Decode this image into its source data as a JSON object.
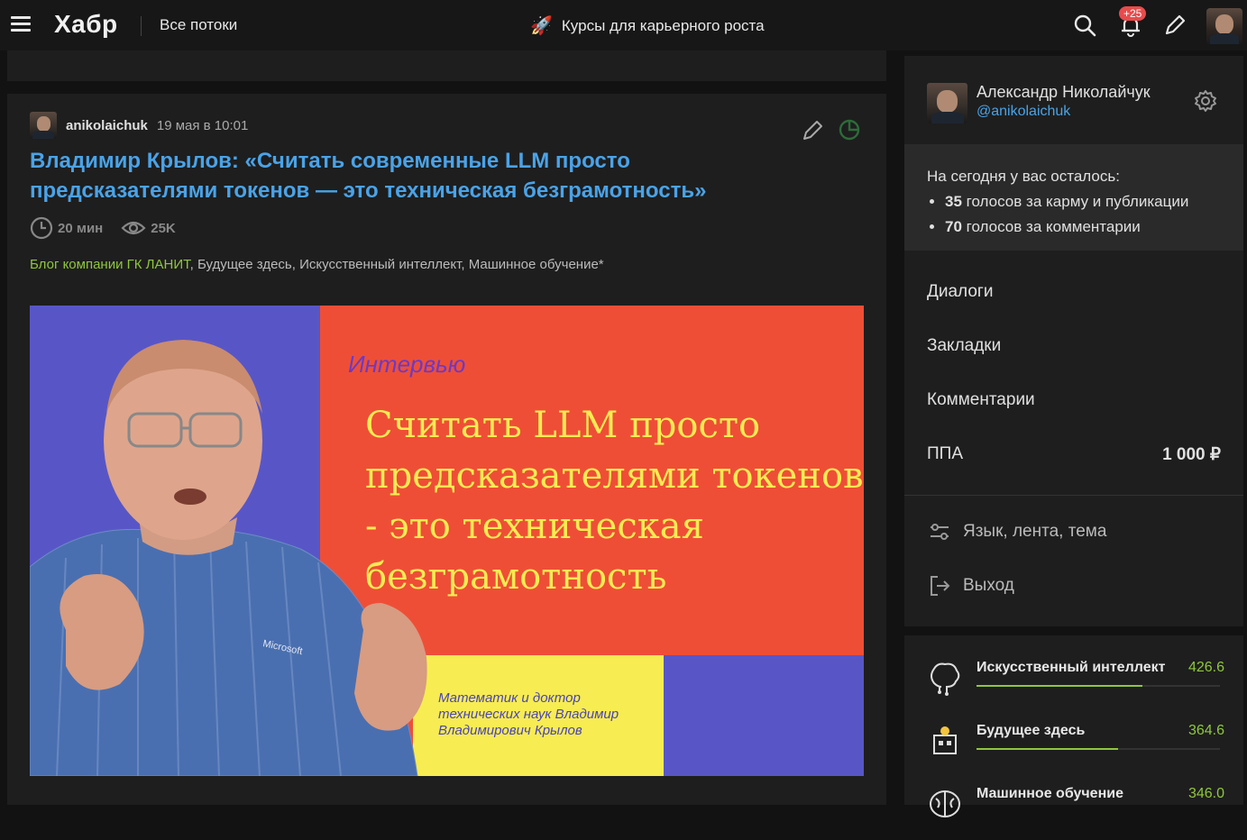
{
  "header": {
    "logo": "Хабр",
    "flows_label": "Все потоки",
    "promo_text": "Курсы для карьерного роста",
    "notifications_badge": "+25"
  },
  "article": {
    "author": "anikolaichuk",
    "date": "19 мая в 10:01",
    "title": "Владимир Крылов: «Считать современные LLM просто предсказателями токенов — это техническая безграмотность»",
    "read_time": "20 мин",
    "views": "25K",
    "hubs": {
      "company": "Блог компании ГК ЛАНИТ",
      "sep1": ", ",
      "h1": "Будущее здесь",
      "sep2": ", ",
      "h2": "Искусственный интеллект",
      "sep3": ", ",
      "h3": "Машинное обучение*"
    },
    "cover": {
      "kicker": "Интервью",
      "headline": "Считать LLM просто предсказателями токенов - это техническая безграмотность",
      "caption": "Математик и доктор технических наук Владимир Владимирович Крылов"
    }
  },
  "user_menu": {
    "name": "Александр Николайчук",
    "handle": "@anikolaichuk",
    "votes_intro": "На сегодня у вас осталось:",
    "votes_karma_num": "35",
    "votes_karma_text": " голосов за карму и публикации",
    "votes_comments_num": "70",
    "votes_comments_text": " голосов за комментарии",
    "items": [
      {
        "label": "Диалоги",
        "value": ""
      },
      {
        "label": "Закладки",
        "value": ""
      },
      {
        "label": "Комментарии",
        "value": ""
      },
      {
        "label": "ППА",
        "value": "1 000 ₽"
      }
    ],
    "settings_label": "Язык, лента, тема",
    "logout_label": "Выход"
  },
  "hub_ratings": [
    {
      "name": "Искусственный интеллект",
      "score": "426.6",
      "fill": 0.68
    },
    {
      "name": "Будущее здесь",
      "score": "364.6",
      "fill": 0.58
    },
    {
      "name": "Машинное обучение",
      "score": "346.0",
      "fill": 0.55
    }
  ],
  "colors": {
    "link": "#4aa3e8",
    "accent_green": "#8fc73e",
    "badge": "#e74c4c"
  }
}
